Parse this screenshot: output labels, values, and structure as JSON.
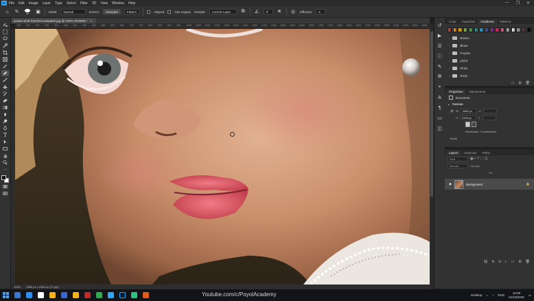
{
  "app": {
    "logo": "Ps",
    "window_controls": [
      "—",
      "❐",
      "✕"
    ]
  },
  "menu": [
    "File",
    "Edit",
    "Image",
    "Layer",
    "Type",
    "Select",
    "Filter",
    "3D",
    "View",
    "Window",
    "Help"
  ],
  "options": {
    "brush_size": "25",
    "mode_label": "Mode:",
    "mode_value": "Normal",
    "source_label": "Source:",
    "source_sampled": "Sampled",
    "source_pattern": "Pattern",
    "aligned_label": "Aligned",
    "use_legacy_label": "Use Legacy",
    "sample_label": "Sample:",
    "sample_value": "Current Layer",
    "angle_value": "0°",
    "diffusion_label": "Diffusion:",
    "diffusion_value": "5"
  },
  "document": {
    "tab_title": "jordan-whitt-Pyerb10-unsplash.jpg @ 100% (RGB/8) *",
    "close": "×"
  },
  "ruler_ticks": [
    "100",
    "150",
    "200",
    "250",
    "300",
    "350",
    "400",
    "450",
    "500",
    "550",
    "600",
    "650",
    "700",
    "750",
    "800",
    "850",
    "900",
    "950",
    "1000",
    "1050",
    "1100",
    "1150",
    "1200",
    "1250",
    "1300",
    "1350",
    "1400",
    "1450",
    "1500",
    "1550",
    "1600",
    "1650",
    "1700",
    "1750",
    "1800",
    "1850",
    "1900",
    "1950",
    "2000",
    "2050",
    "2100",
    "2150",
    "2200",
    "2250"
  ],
  "status": {
    "zoom": "100%",
    "doc_size": "3666 px x 2398 px (72 ppi)"
  },
  "panels": {
    "swatch_tabs": [
      "Color",
      "Swatches",
      "Gradients",
      "Patterns"
    ],
    "active_swatch_tab": "Gradients",
    "gradient_colors": [
      "#e53935",
      "#ff9800",
      "#f4b400",
      "#8bc34a",
      "#4caf50",
      "#26a69a",
      "#03a9f4",
      "#3f51b5",
      "#9c27b0",
      "#e91e63",
      "#f06292",
      "#bdbdbd",
      "#ffffff",
      "#9e9e9e",
      "#5d4037",
      "#000000"
    ],
    "gradient_folders": [
      "Basics",
      "Blues",
      "Purples",
      "Pinks",
      "Reds"
    ],
    "gradient_folders_extra": "pinkd",
    "properties_tabs": [
      "Properties",
      "Adjustments"
    ],
    "properties_doc": "Document",
    "canvas_section": "Canvas",
    "canvas_w_label": "W",
    "canvas_w": "3666 px",
    "canvas_h_label": "H",
    "canvas_h": "2398 px",
    "canvas_x_label": "X",
    "canvas_y_label": "Y",
    "resolution": "Resolution: 72 pixels/inch",
    "mode_label": "Mode",
    "layers_tabs": [
      "Layers",
      "Channels",
      "Paths"
    ],
    "layer_kind": "Kind",
    "layer_blend": "Normal",
    "layer_opacity": "Opacity:",
    "layer_fill": "Fill:",
    "layer_name": "Background"
  },
  "taskbar": {
    "watermark": "Youtube.com/c/PoyotAcademy",
    "desktop_label": "Desktop",
    "lang": "ENG",
    "time": "10:59",
    "date": "01/10/2020",
    "app_colors": [
      "#3a78d6",
      "#2d8ef0",
      "#ffffff",
      "#f2b21b",
      "#3b66d6",
      "#f2b21b",
      "#c62828",
      "#34a853",
      "#31a8ff",
      "#7ac143",
      "#2ec27e",
      "#e05a1c"
    ]
  }
}
